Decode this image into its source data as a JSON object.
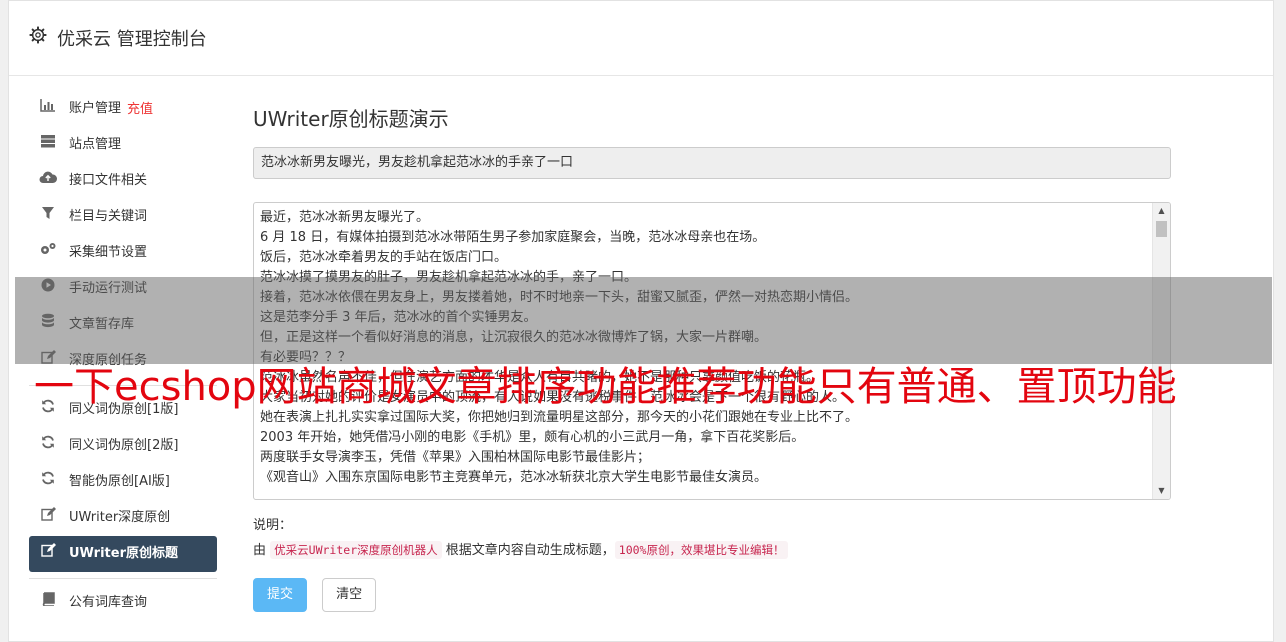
{
  "header": {
    "title": "优采云 管理控制台",
    "icon": "gear-icon"
  },
  "sidebar": {
    "items": [
      {
        "label": "账户管理",
        "extra": "充值",
        "icon": "bar-chart-icon"
      },
      {
        "label": "站点管理",
        "icon": "server-icon"
      },
      {
        "label": "接口文件相关",
        "icon": "cloud-upload-icon"
      },
      {
        "label": "栏目与关键词",
        "icon": "filter-icon"
      },
      {
        "label": "采集细节设置",
        "icon": "gears-icon"
      },
      {
        "label": "手动运行测试",
        "icon": "play-circle-icon"
      },
      {
        "label": "文章暂存库",
        "icon": "database-icon"
      },
      {
        "label": "深度原创任务",
        "icon": "edit-icon"
      },
      {
        "label": "同义词伪原创[1版]",
        "icon": "refresh-icon"
      },
      {
        "label": "同义词伪原创[2版]",
        "icon": "refresh-icon"
      },
      {
        "label": "智能伪原创[AI版]",
        "icon": "refresh-icon"
      },
      {
        "label": "UWriter深度原创",
        "icon": "edit-icon"
      },
      {
        "label": "UWriter原创标题",
        "icon": "edit-icon",
        "active": true
      },
      {
        "label": "公有词库查询",
        "icon": "book-icon"
      }
    ]
  },
  "main": {
    "heading": "UWriter原创标题演示",
    "title_value": "范冰冰新男友曝光，男友趁机拿起范冰冰的手亲了一口",
    "content_lines": [
      "最近，范冰冰新男友曝光了。",
      "6 月 18 日，有媒体拍摄到范冰冰带陌生男子参加家庭聚会，当晚，范冰冰母亲也在场。",
      "饭后，范冰冰牵着男友的手站在饭店门口。",
      "范冰冰摸了摸男友的肚子，男友趁机拿起范冰冰的手，亲了一口。",
      "接着，范冰冰依偎在男友身上，男友搂着她，时不时地亲一下头，甜蜜又腻歪，俨然一对热恋期小情侣。",
      "这是范李分手 3 年后，范冰冰的首个实锤男友。",
      "但，正是这样一个看似好消息的消息，让沉寂很久的范冰冰微博炸了锅，大家一片群嘲。",
      "有必要吗？？？",
      "范冰冰虽然名声不佳，但在演艺方面的才华是众人有目共睹的，她不是那种只靠颜值吃饭的花瓶。",
      "大家当初对她的评价是女演员中的顶流，有人说如果没有逃税事件，范冰冰会是下一个很有野心的人。",
      "她在表演上扎扎实实拿过国际大奖，你把她归到流量明星这部分，那今天的小花们跟她在专业上比不了。",
      "2003 年开始，她凭借冯小刚的电影《手机》里，颇有心机的小三武月一角，拿下百花奖影后。",
      "两度联手女导演李玉，凭借《苹果》入围柏林国际电影节最佳影片；",
      "《观音山》入围东京国际电影节主竞赛单元，范冰冰斩获北京大学生电影节最佳女演员。"
    ],
    "note_label": "说明：",
    "note_prefix": "由",
    "note_code1": "优采云UWriter深度原创机器人",
    "note_middle": "根据文章内容自动生成标题，",
    "note_code2": "100%原创，效果堪比专业编辑！",
    "submit_label": "提交",
    "clear_label": "清空"
  },
  "overlay": {
    "title": "一下ecshop网站商城文章排序功能推荐功能只有普通、置顶功能"
  },
  "colors": {
    "active_bg": "#34495e",
    "primary_button": "#5bb8f5",
    "accent_red": "#e3050f",
    "code_color": "#c7254e"
  }
}
